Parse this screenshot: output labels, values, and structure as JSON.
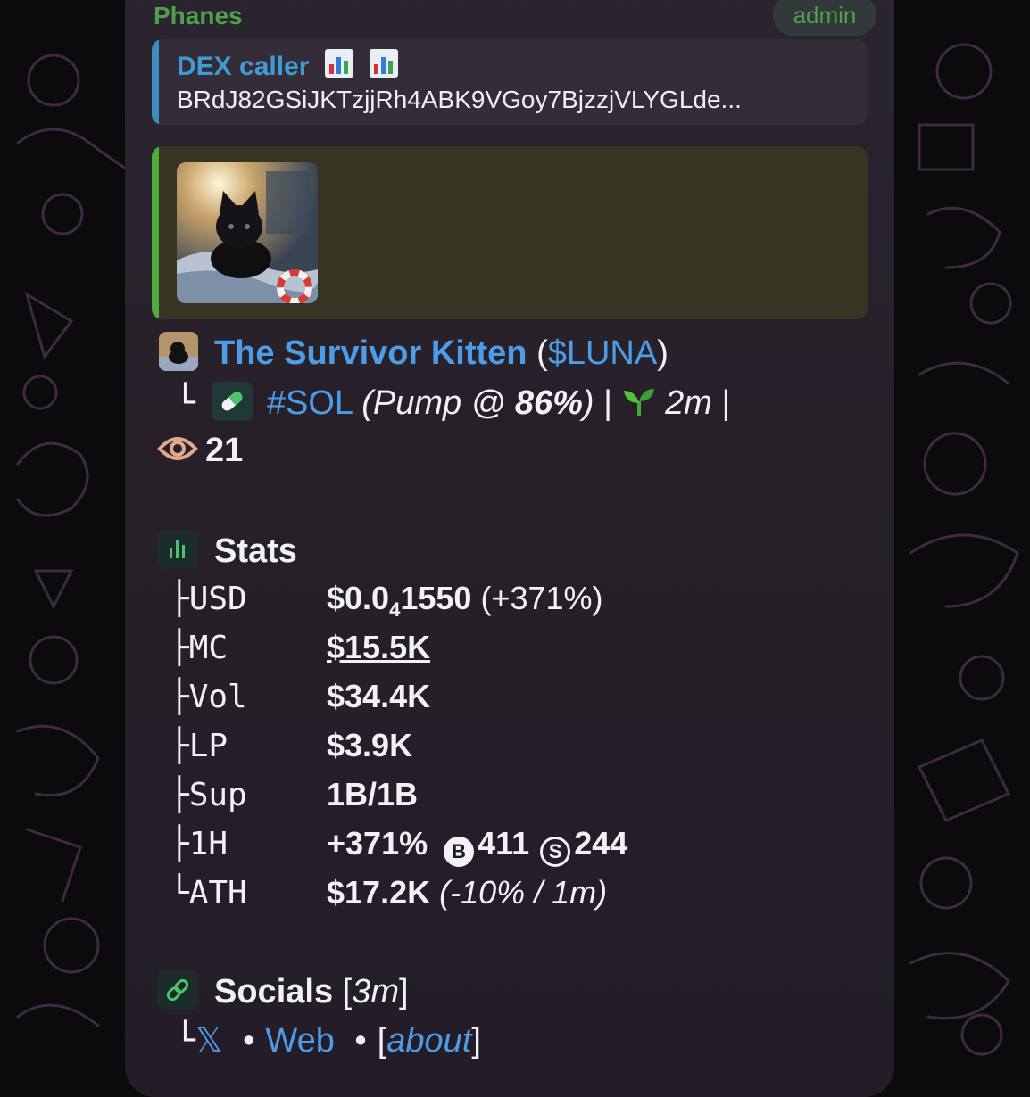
{
  "message": {
    "sender": "Phanes",
    "badge": "admin",
    "reply": {
      "name": "DEX caller",
      "emoji": "chart-bar-emoji",
      "text": "BRdJ82GSiJKTzjjRh4ABK9VGoy7BjzzjVLYGLde..."
    },
    "preview_image": "kitten-image",
    "token": {
      "name": "The Survivor Kitten",
      "paren_open": "(",
      "ticker": "$LUNA",
      "paren_close": ")"
    },
    "chain": {
      "corner": "└",
      "tag": "#SOL",
      "pump_prefix": "(Pump @ ",
      "pump_pct": "86%",
      "pump_suffix": ")",
      "sep": "|",
      "age": "2m",
      "sep2": "|"
    },
    "views": "21",
    "stats": {
      "heading": "Stats",
      "rows": [
        {
          "branch": "├",
          "label": "USD",
          "value": "$0.0",
          "sub": "4",
          "value2": "1550",
          "extra": "(+371%)"
        },
        {
          "branch": "├",
          "label": "MC",
          "value": "$15.5K"
        },
        {
          "branch": "├",
          "label": "Vol",
          "value": "$34.4K"
        },
        {
          "branch": "├",
          "label": "LP",
          "value": "$3.9K"
        },
        {
          "branch": "├",
          "label": "Sup",
          "value": "1B/1B"
        },
        {
          "branch": "├",
          "label": "1H",
          "value": "+371%",
          "buy_icon": "B",
          "buys": "411",
          "sell_icon": "S",
          "sells": "244"
        },
        {
          "branch": "└",
          "label": "ATH",
          "value": "$17.2K",
          "extra": "(-10% / 1m)"
        }
      ]
    },
    "socials": {
      "heading": "Socials",
      "age_open": "[",
      "age": "3m",
      "age_close": "]",
      "corner": "└",
      "x_label": "𝕏",
      "dot": "•",
      "web_label": "Web",
      "about_open": "[",
      "about_label": "about",
      "about_close": "]"
    }
  },
  "colors": {
    "sender": "#4fa04a",
    "link": "#4c9ce8",
    "reply_bar": "#3b8fc0",
    "preview_bar": "#4cae3a"
  }
}
